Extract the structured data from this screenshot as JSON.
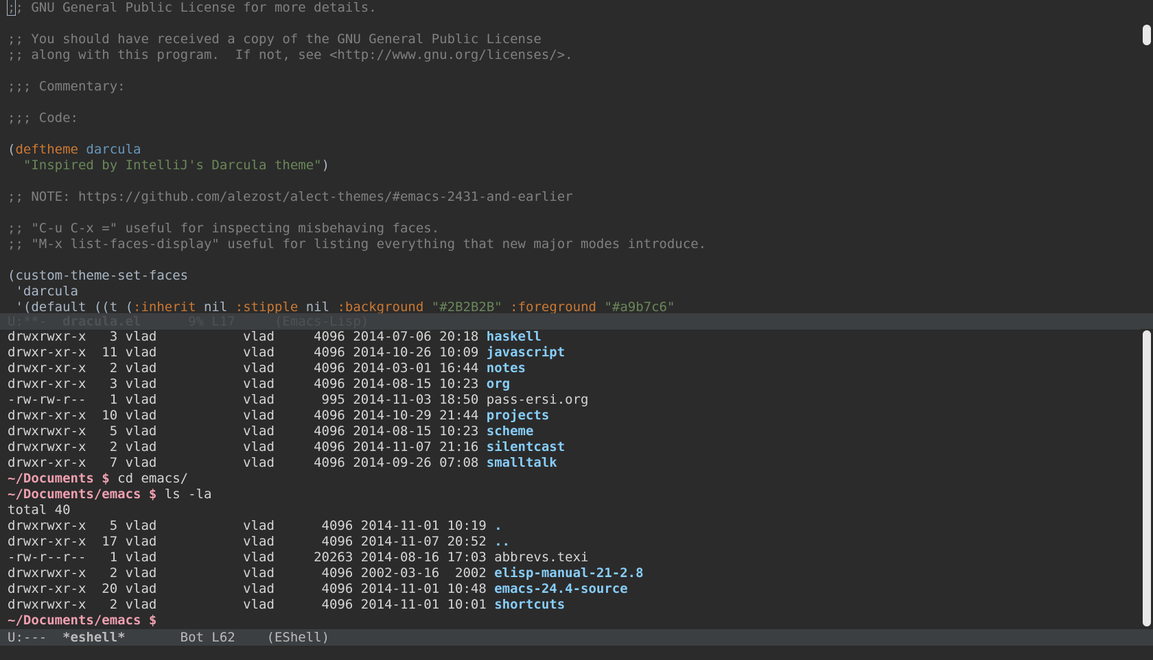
{
  "top_buffer": {
    "lines": [
      [
        {
          "c": "cm",
          "t": ";; GNU General Public License for more details."
        }
      ],
      [],
      [
        {
          "c": "cm",
          "t": ";; You should have received a copy of the GNU General Public License"
        }
      ],
      [
        {
          "c": "cm",
          "t": ";; along with this program.  If not, see <http://www.gnu.org/licenses/>."
        }
      ],
      [],
      [
        {
          "c": "cm",
          "t": ";;; Commentary:"
        }
      ],
      [],
      [
        {
          "c": "cm",
          "t": ";;; Code:"
        }
      ],
      [],
      [
        {
          "c": "tx",
          "t": "("
        },
        {
          "c": "kw",
          "t": "deftheme"
        },
        {
          "c": "tx",
          "t": " "
        },
        {
          "c": "fn",
          "t": "darcula"
        }
      ],
      [
        {
          "c": "tx",
          "t": "  "
        },
        {
          "c": "st",
          "t": "\"Inspired by IntelliJ's Darcula theme\""
        },
        {
          "c": "tx",
          "t": ")"
        }
      ],
      [],
      [
        {
          "c": "cm",
          "t": ";; NOTE: https://github.com/alezost/alect-themes/#emacs-2431-and-earlier"
        }
      ],
      [],
      [
        {
          "c": "cm",
          "t": ";; \"C-u C-x =\" useful for inspecting misbehaving faces."
        }
      ],
      [
        {
          "c": "cm",
          "t": ";; \"M-x list-faces-display\" useful for listing everything that new major modes introduce."
        }
      ],
      [],
      [
        {
          "c": "tx",
          "t": "(custom-theme-set-faces"
        }
      ],
      [
        {
          "c": "tx",
          "t": " 'darcula"
        }
      ],
      [
        {
          "c": "tx",
          "t": " '(default ((t ("
        },
        {
          "c": "kw",
          "t": ":inherit"
        },
        {
          "c": "tx",
          "t": " nil "
        },
        {
          "c": "kw",
          "t": ":stipple"
        },
        {
          "c": "tx",
          "t": " nil "
        },
        {
          "c": "kw",
          "t": ":background"
        },
        {
          "c": "tx",
          "t": " "
        },
        {
          "c": "st",
          "t": "\"#2B2B2B\""
        },
        {
          "c": "tx",
          "t": " "
        },
        {
          "c": "kw",
          "t": ":foreground"
        },
        {
          "c": "tx",
          "t": " "
        },
        {
          "c": "st",
          "t": "\"#a9b7c6\""
        }
      ]
    ]
  },
  "top_modeline": {
    "status": "U:**-  ",
    "buffer": "dracula.el",
    "position": "      9% L17     ",
    "mode": "(Emacs-Lisp)"
  },
  "bottom_buffer": {
    "lines": [
      [
        {
          "c": "perm",
          "t": "drwxrwxr-x   3 vlad           vlad     4096 2014-07-06 20:18 "
        },
        {
          "c": "dir",
          "t": "haskell"
        }
      ],
      [
        {
          "c": "perm",
          "t": "drwxr-xr-x  11 vlad           vlad     4096 2014-10-26 10:09 "
        },
        {
          "c": "dir",
          "t": "javascript"
        }
      ],
      [
        {
          "c": "perm",
          "t": "drwxr-xr-x   2 vlad           vlad     4096 2014-03-01 16:44 "
        },
        {
          "c": "dir",
          "t": "notes"
        }
      ],
      [
        {
          "c": "perm",
          "t": "drwxr-xr-x   3 vlad           vlad     4096 2014-08-15 10:23 "
        },
        {
          "c": "dir",
          "t": "org"
        }
      ],
      [
        {
          "c": "perm",
          "t": "-rw-rw-r--   1 vlad           vlad      995 2014-11-03 18:50 "
        },
        {
          "c": "file",
          "t": "pass-ersi.org"
        }
      ],
      [
        {
          "c": "perm",
          "t": "drwxr-xr-x  10 vlad           vlad     4096 2014-10-29 21:44 "
        },
        {
          "c": "dir",
          "t": "projects"
        }
      ],
      [
        {
          "c": "perm",
          "t": "drwxrwxr-x   5 vlad           vlad     4096 2014-08-15 10:23 "
        },
        {
          "c": "dir",
          "t": "scheme"
        }
      ],
      [
        {
          "c": "perm",
          "t": "drwxrwxr-x   2 vlad           vlad     4096 2014-11-07 21:16 "
        },
        {
          "c": "dir",
          "t": "silentcast"
        }
      ],
      [
        {
          "c": "perm",
          "t": "drwxr-xr-x   7 vlad           vlad     4096 2014-09-26 07:08 "
        },
        {
          "c": "dir",
          "t": "smalltalk"
        }
      ],
      [
        {
          "c": "prompt",
          "t": "~/Documents $"
        },
        {
          "c": "cmd",
          "t": " cd emacs/"
        }
      ],
      [
        {
          "c": "prompt",
          "t": "~/Documents/emacs $"
        },
        {
          "c": "cmd",
          "t": " ls -la"
        }
      ],
      [
        {
          "c": "cmd",
          "t": "total 40"
        }
      ],
      [
        {
          "c": "perm",
          "t": "drwxrwxr-x   5 vlad           vlad      4096 2014-11-01 10:19 "
        },
        {
          "c": "dir",
          "t": "."
        }
      ],
      [
        {
          "c": "perm",
          "t": "drwxr-xr-x  17 vlad           vlad      4096 2014-11-07 20:52 "
        },
        {
          "c": "dir",
          "t": ".."
        }
      ],
      [
        {
          "c": "perm",
          "t": "-rw-r--r--   1 vlad           vlad     20263 2014-08-16 17:03 "
        },
        {
          "c": "file",
          "t": "abbrevs.texi"
        }
      ],
      [
        {
          "c": "perm",
          "t": "drwxrwxr-x   2 vlad           vlad      4096 2002-03-16  2002 "
        },
        {
          "c": "dir",
          "t": "elisp-manual-21-2.8"
        }
      ],
      [
        {
          "c": "perm",
          "t": "drwxr-xr-x  20 vlad           vlad      4096 2014-11-01 10:48 "
        },
        {
          "c": "dir",
          "t": "emacs-24.4-source"
        }
      ],
      [
        {
          "c": "perm",
          "t": "drwxrwxr-x   2 vlad           vlad      4096 2014-11-01 10:01 "
        },
        {
          "c": "dir",
          "t": "shortcuts"
        }
      ],
      [
        {
          "c": "prompt",
          "t": "~/Documents/emacs $"
        },
        {
          "c": "cmd",
          "t": " "
        }
      ]
    ]
  },
  "bottom_modeline": {
    "status": "U:---  ",
    "buffer": "*eshell*",
    "position": "       Bot L62    ",
    "mode": "(EShell)"
  },
  "colors": {
    "background": "#2B2B2B",
    "foreground": "#a9b7c6",
    "keyword": "#cc7832",
    "string": "#6a8759",
    "comment": "#808080",
    "directory": "#87cefa",
    "prompt": "#f0a0b0"
  }
}
